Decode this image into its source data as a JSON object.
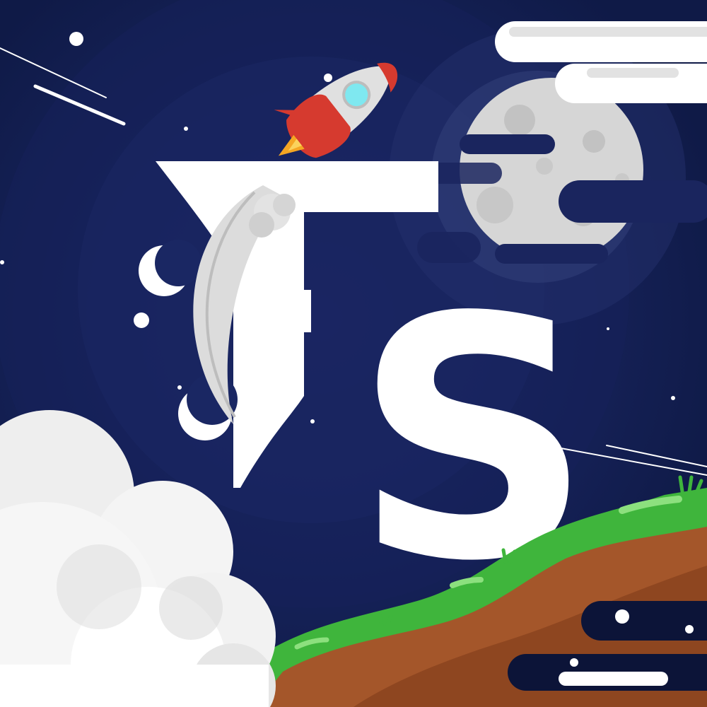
{
  "logo": {
    "text": "FS",
    "color": "#ffffff"
  },
  "colors": {
    "sky": "#0f1a47",
    "sky_glow": "#18245c",
    "sky_glow_inner": "#1c2a66",
    "moon": "#d9d9d9",
    "moon_crater": "#bdbdbd",
    "rocket_body": "#e3e3e3",
    "rocket_red": "#d93b30",
    "rocket_window": "#7fe8f0",
    "flame": "#f5a623",
    "smoke": "#e6e6e6",
    "cloud": "#f2f2f2",
    "grass": "#3fb53c",
    "grass_light": "#7be06f",
    "dirt": "#a4562a",
    "dirt_dark": "#7d3d1c",
    "streak_dark": "#0c1438",
    "streak_light": "#e8e8e8"
  },
  "icons": [
    "rocket-icon",
    "moon-icon",
    "crescent-moon-icon",
    "cloud-icon",
    "star-icon",
    "hill-icon"
  ]
}
